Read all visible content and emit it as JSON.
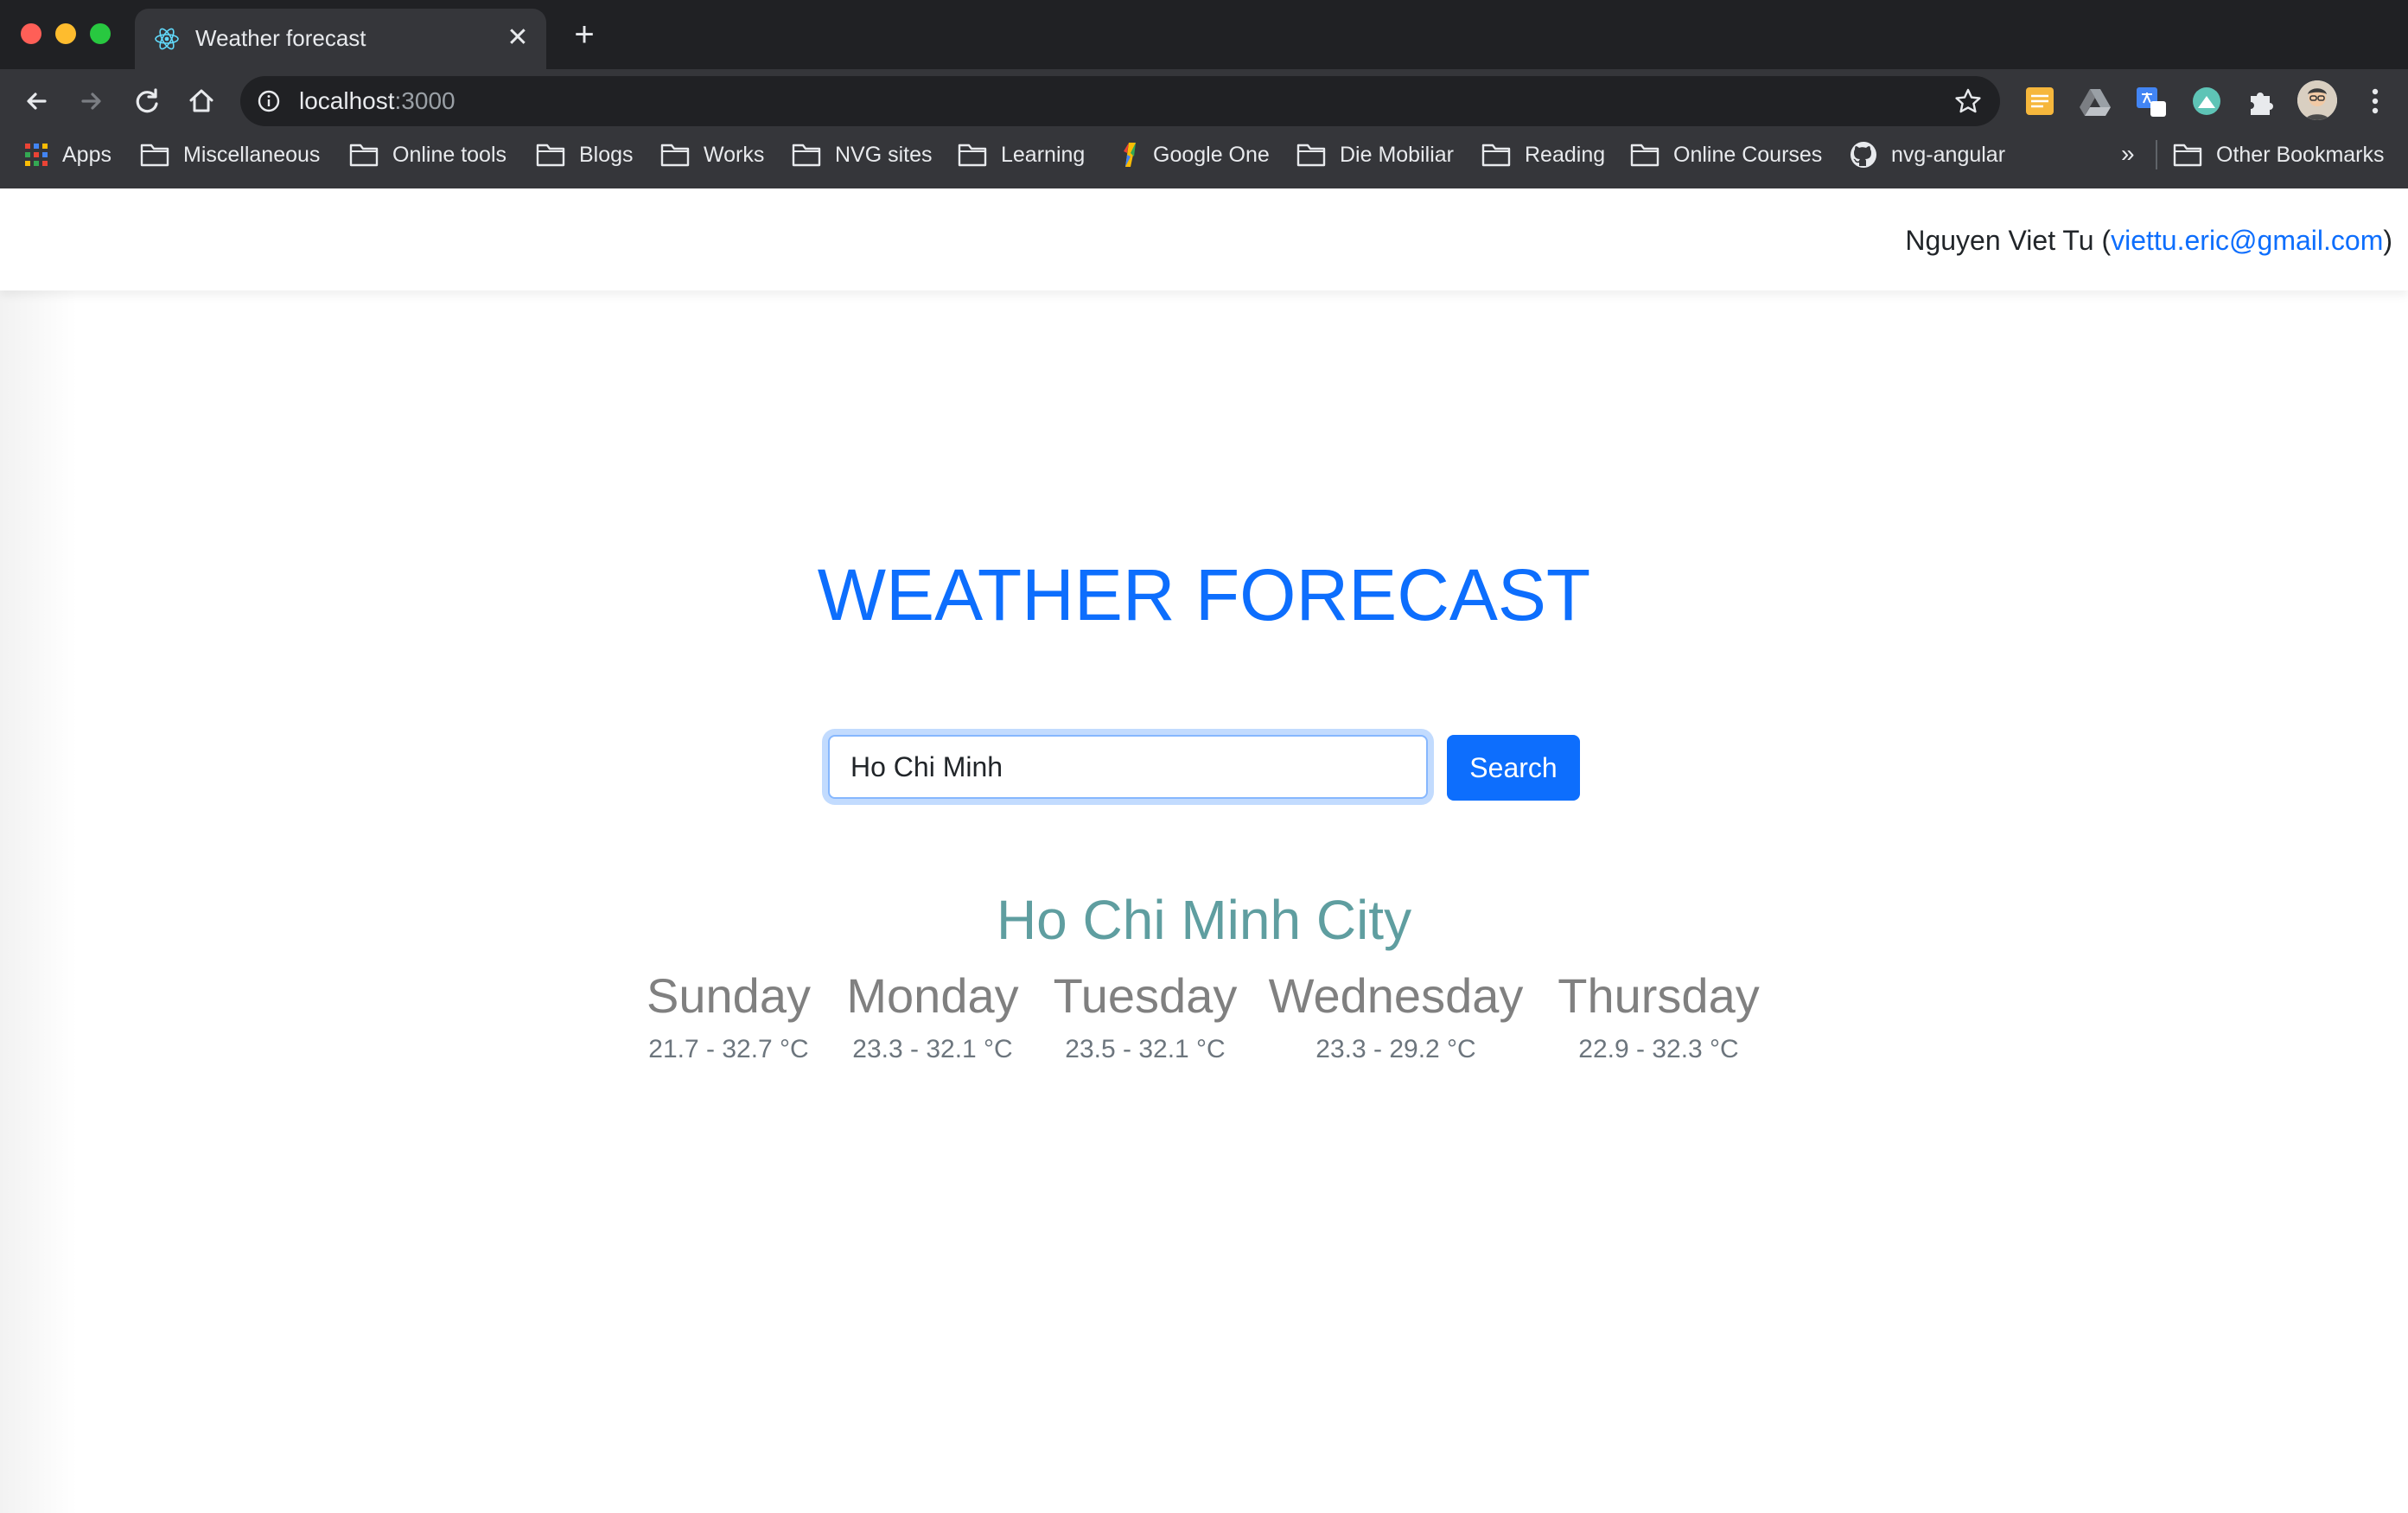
{
  "browser": {
    "tab_title": "Weather forecast",
    "url_host": "localhost",
    "url_port": ":3000",
    "bookmarks": [
      {
        "label": "Apps",
        "icon": "apps-grid-icon"
      },
      {
        "label": "Miscellaneous",
        "icon": "folder-icon"
      },
      {
        "label": "Online tools",
        "icon": "folder-icon"
      },
      {
        "label": "Blogs",
        "icon": "folder-icon"
      },
      {
        "label": "Works",
        "icon": "folder-icon"
      },
      {
        "label": "NVG sites",
        "icon": "folder-icon"
      },
      {
        "label": "Learning",
        "icon": "folder-icon"
      },
      {
        "label": "Google One",
        "icon": "google-one-icon"
      },
      {
        "label": "Die Mobiliar",
        "icon": "folder-icon"
      },
      {
        "label": "Reading",
        "icon": "folder-icon"
      },
      {
        "label": "Online Courses",
        "icon": "folder-icon"
      },
      {
        "label": "nvg-angular",
        "icon": "github-icon"
      }
    ],
    "bookmarks_overflow": "»",
    "other_bookmarks": "Other Bookmarks"
  },
  "header": {
    "author_name": "Nguyen Viet Tu",
    "open_paren": " (",
    "email": "viettu.eric@gmail.com",
    "close_paren": ")"
  },
  "app": {
    "title": "WEATHER FORECAST",
    "search_value": "Ho Chi Minh",
    "search_button": "Search",
    "city": "Ho Chi Minh City",
    "forecast": [
      {
        "day": "Sunday",
        "temp": "21.7 - 32.7 °C"
      },
      {
        "day": "Monday",
        "temp": "23.3 - 32.1 °C"
      },
      {
        "day": "Tuesday",
        "temp": "23.5 - 32.1 °C"
      },
      {
        "day": "Wednesday",
        "temp": "23.3 - 29.2 °C"
      },
      {
        "day": "Thursday",
        "temp": "22.9 - 32.3 °C"
      }
    ]
  },
  "colors": {
    "accent": "#0d6efd",
    "city": "#5f9ea0",
    "day_text": "#808080"
  }
}
